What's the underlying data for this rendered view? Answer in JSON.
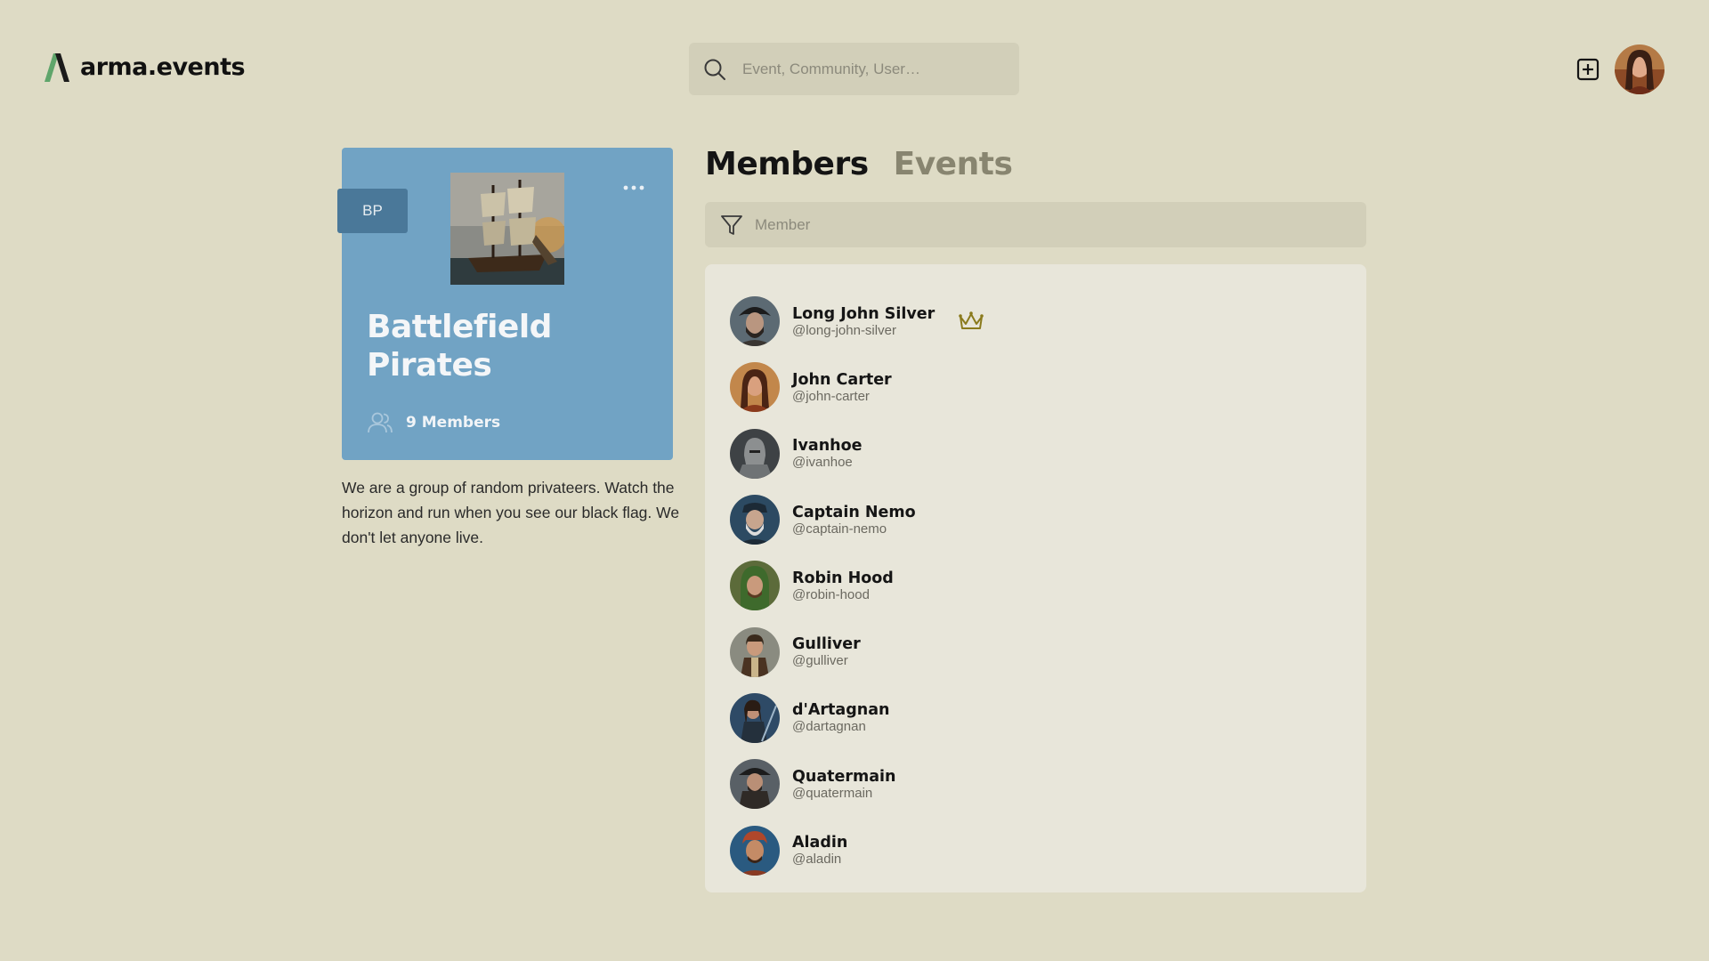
{
  "app": {
    "brand_name": "arma.events",
    "brand_color": "#5fa56b",
    "background": "#dedbc5"
  },
  "header": {
    "search_placeholder": "Event, Community, User…",
    "search_icon": "search-icon",
    "add_icon": "plus-square-icon"
  },
  "community": {
    "tag": "BP",
    "name": "Battlefield Pirates",
    "members_label": "9 Members",
    "card_color": "#71a3c4",
    "description": "We are a group of random privateers. Watch the horizon and run when you see our black flag. We don't let anyone live."
  },
  "tabs": [
    {
      "label": "Members",
      "active": true
    },
    {
      "label": "Events",
      "active": false
    }
  ],
  "filter": {
    "placeholder": "Member"
  },
  "members": [
    {
      "name": "Long John Silver",
      "handle": "@long-john-silver",
      "owner": true
    },
    {
      "name": "John Carter",
      "handle": "@john-carter"
    },
    {
      "name": "Ivanhoe",
      "handle": "@ivanhoe"
    },
    {
      "name": "Captain Nemo",
      "handle": "@captain-nemo"
    },
    {
      "name": "Robin Hood",
      "handle": "@robin-hood"
    },
    {
      "name": "Gulliver",
      "handle": "@gulliver"
    },
    {
      "name": "d'Artagnan",
      "handle": "@dartagnan"
    },
    {
      "name": "Quatermain",
      "handle": "@quatermain"
    },
    {
      "name": "Aladin",
      "handle": "@aladin"
    }
  ]
}
